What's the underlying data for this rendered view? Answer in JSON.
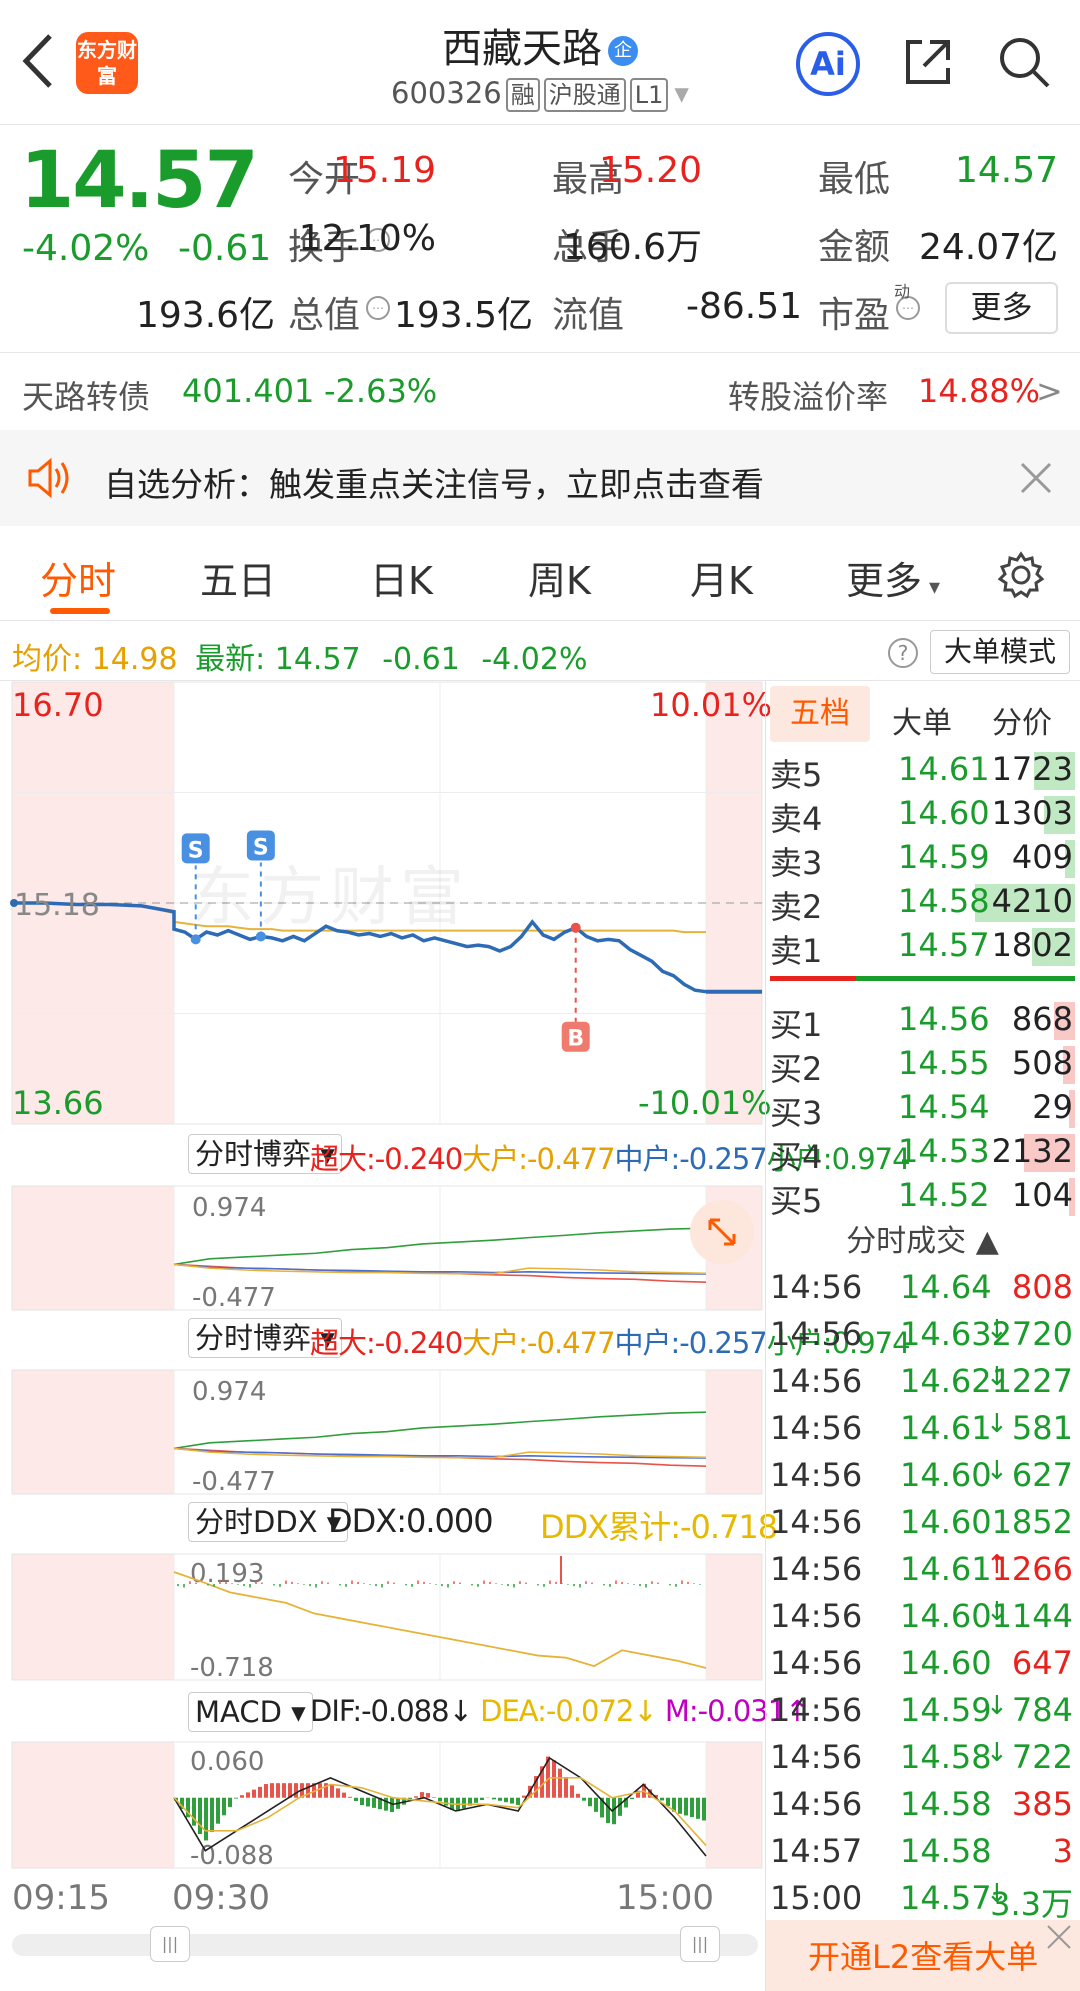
{
  "header": {
    "title": "西藏天路",
    "badge": "企",
    "code": "600326",
    "tags": [
      "融",
      "沪股通",
      "L1"
    ],
    "logo": "东方财富",
    "ai": "Ai"
  },
  "quote": {
    "price": "14.57",
    "change_pct": "-4.02%",
    "change": "-0.61",
    "items": [
      {
        "label": "今开",
        "value": "15.19",
        "color": "#e8221d"
      },
      {
        "label": "最高",
        "value": "15.20",
        "color": "#e8221d"
      },
      {
        "label": "最低",
        "value": "14.57",
        "color": "#1a9c2c"
      },
      {
        "label": "换手",
        "value": "12.10%",
        "color": "#222"
      },
      {
        "label": "总手",
        "value": "160.6万",
        "color": "#222"
      },
      {
        "label": "金额",
        "value": "24.07亿",
        "color": "#222"
      },
      {
        "label": "总值",
        "value": "193.6亿",
        "color": "#222"
      },
      {
        "label": "流值",
        "value": "193.5亿",
        "color": "#222"
      },
      {
        "label": "市盈",
        "value": "-86.51",
        "color": "#222"
      }
    ],
    "pe_sup": "动",
    "more": "更多"
  },
  "bond": {
    "name": "天路转债",
    "price": "401.401",
    "pct": "-2.63%",
    "premium_label": "转股溢价率",
    "premium": "14.88%"
  },
  "notice": {
    "text": "自选分析：触发重点关注信号，立即点击查看"
  },
  "tabs": [
    "分时",
    "五日",
    "日K",
    "周K",
    "月K",
    "更多"
  ],
  "chart_info": {
    "avg_label": "均价:",
    "avg": "14.98",
    "last_label": "最新:",
    "last": "14.57",
    "change": "-0.61",
    "pct": "-4.02%",
    "mode": "大单模式"
  },
  "chart_data": [
    {
      "type": "line",
      "name": "intraday-price",
      "y_top": "16.70",
      "y_bottom": "13.66",
      "pct_top": "10.01%",
      "pct_bottom": "-10.01%",
      "ref": "15.18",
      "watermark": "东方财富",
      "x_labels": [
        "09:15",
        "09:30",
        "15:00"
      ],
      "series": [
        {
          "values": [
            15.18,
            15.18,
            15.17,
            15.17,
            15.16,
            15.12,
            15.0,
            14.98,
            14.93,
            14.98,
            14.96,
            14.99,
            14.96,
            14.93,
            14.95,
            14.94,
            14.92,
            14.95,
            14.92,
            14.97,
            15.02,
            14.99,
            14.98,
            14.96,
            14.97,
            14.95,
            14.97,
            14.94,
            14.96,
            14.92,
            14.94,
            14.92,
            14.9,
            14.88,
            14.89,
            14.88,
            14.85,
            14.88,
            14.95,
            15.05,
            14.96,
            14.93,
            14.98,
            15.01,
            14.95,
            14.92,
            14.93,
            14.92,
            14.86,
            14.82,
            14.78,
            14.71,
            14.68,
            14.62,
            14.58,
            14.57
          ]
        },
        {
          "values": [
            15.18,
            15.18,
            15.17,
            15.17,
            15.16,
            15.11,
            15.05,
            15.04,
            15.03,
            15.02,
            15.02,
            15.02,
            15.01,
            15.0,
            15.0,
            15.0,
            14.99,
            14.99,
            14.99,
            14.99,
            14.99,
            14.99,
            14.99,
            14.99,
            14.99,
            14.99,
            14.99,
            14.99,
            14.99,
            14.99,
            14.99,
            14.99,
            14.99,
            14.99,
            14.99,
            14.99,
            14.99,
            14.99,
            14.99,
            14.99,
            14.99,
            14.99,
            14.99,
            14.99,
            14.99,
            14.99,
            14.99,
            14.99,
            14.99,
            14.99,
            14.99,
            14.99,
            14.99,
            14.98,
            14.98,
            14.98
          ]
        }
      ],
      "markers": [
        {
          "label": "S"
        },
        {
          "label": "S"
        },
        {
          "label": "B"
        }
      ]
    },
    {
      "type": "line",
      "name": "game-1",
      "selector": "分时博弈",
      "labels": [
        "超大:-0.240",
        "大户:-0.477",
        "中户:-0.257",
        "小户:0.974"
      ],
      "ymax": "0.974",
      "ymin": "-0.477",
      "series": [
        {
          "values": [
            0.0,
            0.15,
            0.2,
            0.25,
            0.3,
            0.4,
            0.45,
            0.55,
            0.6,
            0.65,
            0.72,
            0.78,
            0.85,
            0.9,
            0.95,
            0.974
          ]
        },
        {
          "values": [
            0.0,
            -0.05,
            -0.1,
            -0.12,
            -0.15,
            -0.18,
            -0.2,
            -0.22,
            -0.25,
            -0.28,
            -0.3,
            -0.35,
            -0.38,
            -0.4,
            -0.45,
            -0.477
          ]
        },
        {
          "values": [
            0.0,
            -0.08,
            -0.1,
            -0.12,
            -0.15,
            -0.16,
            -0.18,
            -0.2,
            -0.2,
            -0.22,
            -0.2,
            -0.22,
            -0.23,
            -0.24,
            -0.25,
            -0.257
          ]
        },
        {
          "values": [
            0.0,
            -0.1,
            -0.15,
            -0.18,
            -0.2,
            -0.22,
            -0.22,
            -0.24,
            -0.25,
            -0.25,
            -0.1,
            -0.12,
            -0.15,
            -0.2,
            -0.22,
            -0.24
          ]
        }
      ]
    },
    {
      "type": "line",
      "name": "game-2",
      "selector": "分时博弈",
      "labels": [
        "超大:-0.240",
        "大户:-0.477",
        "中户:-0.257",
        "小户:0.974"
      ],
      "ymax": "0.974",
      "ymin": "-0.477",
      "series": [
        {
          "values": [
            0.0,
            0.15,
            0.2,
            0.25,
            0.3,
            0.4,
            0.45,
            0.55,
            0.6,
            0.65,
            0.72,
            0.78,
            0.85,
            0.9,
            0.95,
            0.974
          ]
        },
        {
          "values": [
            0.0,
            -0.05,
            -0.1,
            -0.12,
            -0.15,
            -0.18,
            -0.2,
            -0.22,
            -0.25,
            -0.28,
            -0.3,
            -0.35,
            -0.38,
            -0.4,
            -0.45,
            -0.477
          ]
        },
        {
          "values": [
            0.0,
            -0.08,
            -0.1,
            -0.12,
            -0.15,
            -0.16,
            -0.18,
            -0.2,
            -0.2,
            -0.22,
            -0.2,
            -0.22,
            -0.23,
            -0.24,
            -0.25,
            -0.257
          ]
        },
        {
          "values": [
            0.0,
            -0.1,
            -0.15,
            -0.18,
            -0.2,
            -0.22,
            -0.22,
            -0.24,
            -0.25,
            -0.25,
            -0.1,
            -0.12,
            -0.15,
            -0.2,
            -0.22,
            -0.24
          ]
        }
      ]
    },
    {
      "type": "line",
      "name": "ddx",
      "selector": "分时DDX",
      "ddx": "DDX:0.000",
      "cum": "DDX累计:-0.718",
      "ymax": "0.193",
      "ymin": "-0.718",
      "series": [
        {
          "values": [
            0.193,
            0.1,
            0.0,
            -0.05,
            -0.1,
            -0.2,
            -0.25,
            -0.3,
            -0.35,
            -0.4,
            -0.45,
            -0.5,
            -0.55,
            -0.6,
            -0.62,
            -0.7,
            -0.55,
            -0.6,
            -0.65,
            -0.718
          ]
        }
      ]
    },
    {
      "type": "line",
      "name": "macd",
      "selector": "MACD",
      "dif": "DIF:-0.088",
      "dea": "DEA:-0.072",
      "m": "M:-0.031",
      "ymax": "0.060",
      "ymin": "-0.088",
      "series": [
        {
          "values": [
            0.0,
            -0.08,
            -0.05,
            -0.02,
            0.01,
            0.03,
            0.01,
            -0.01,
            0.0,
            -0.02,
            -0.01,
            -0.02,
            0.06,
            0.03,
            -0.02,
            0.02,
            -0.03,
            -0.088
          ]
        },
        {
          "values": [
            0.0,
            -0.05,
            -0.05,
            -0.03,
            0.0,
            0.02,
            0.015,
            0.0,
            -0.005,
            -0.01,
            -0.01,
            -0.015,
            0.03,
            0.03,
            0.0,
            0.01,
            -0.02,
            -0.072
          ]
        }
      ]
    }
  ],
  "orderbook": {
    "tabs": [
      "五档",
      "大单",
      "分价"
    ],
    "asks": [
      {
        "label": "卖5",
        "price": "14.61",
        "vol": "1723"
      },
      {
        "label": "卖4",
        "price": "14.60",
        "vol": "1303"
      },
      {
        "label": "卖3",
        "price": "14.59",
        "vol": "409"
      },
      {
        "label": "卖2",
        "price": "14.58",
        "vol": "4210"
      },
      {
        "label": "卖1",
        "price": "14.57",
        "vol": "1802"
      }
    ],
    "bids": [
      {
        "label": "买1",
        "price": "14.56",
        "vol": "868"
      },
      {
        "label": "买2",
        "price": "14.55",
        "vol": "508"
      },
      {
        "label": "买3",
        "price": "14.54",
        "vol": "29"
      },
      {
        "label": "买4",
        "price": "14.53",
        "vol": "2132"
      },
      {
        "label": "买5",
        "price": "14.52",
        "vol": "104"
      }
    ]
  },
  "trades": {
    "title": "分时成交",
    "rows": [
      {
        "time": "14:56",
        "price": "14.64",
        "arrow": "",
        "vol": "808",
        "vc": "#e8221d"
      },
      {
        "time": "14:56",
        "price": "14.63",
        "arrow": "↓",
        "vol": "2720",
        "vc": "#1a9c2c"
      },
      {
        "time": "14:56",
        "price": "14.62",
        "arrow": "↓",
        "vol": "1227",
        "vc": "#1a9c2c"
      },
      {
        "time": "14:56",
        "price": "14.61",
        "arrow": "↓",
        "vol": "581",
        "vc": "#1a9c2c"
      },
      {
        "time": "14:56",
        "price": "14.60",
        "arrow": "↓",
        "vol": "627",
        "vc": "#1a9c2c"
      },
      {
        "time": "14:56",
        "price": "14.60",
        "arrow": "",
        "vol": "1852",
        "vc": "#1a9c2c"
      },
      {
        "time": "14:56",
        "price": "14.61",
        "arrow": "↑",
        "vol": "1266",
        "vc": "#e8221d"
      },
      {
        "time": "14:56",
        "price": "14.60",
        "arrow": "↓",
        "vol": "1144",
        "vc": "#1a9c2c"
      },
      {
        "time": "14:56",
        "price": "14.60",
        "arrow": "",
        "vol": "647",
        "vc": "#e8221d"
      },
      {
        "time": "14:56",
        "price": "14.59",
        "arrow": "↓",
        "vol": "784",
        "vc": "#1a9c2c"
      },
      {
        "time": "14:56",
        "price": "14.58",
        "arrow": "↓",
        "vol": "722",
        "vc": "#1a9c2c"
      },
      {
        "time": "14:56",
        "price": "14.58",
        "arrow": "",
        "vol": "385",
        "vc": "#e8221d"
      },
      {
        "time": "14:57",
        "price": "14.58",
        "arrow": "",
        "vol": "3",
        "vc": "#e8221d"
      },
      {
        "time": "15:00",
        "price": "14.57",
        "arrow": "↓",
        "vol": "3.3万",
        "vc": "#1a9c2c"
      }
    ]
  },
  "l2": {
    "text": "开通L2查看大单"
  },
  "colors": {
    "up": "#e8221d",
    "down": "#1a9c2c",
    "accent": "#ff5a00",
    "price_line": "#2d6bb5",
    "avg_line": "#e6b33a"
  }
}
